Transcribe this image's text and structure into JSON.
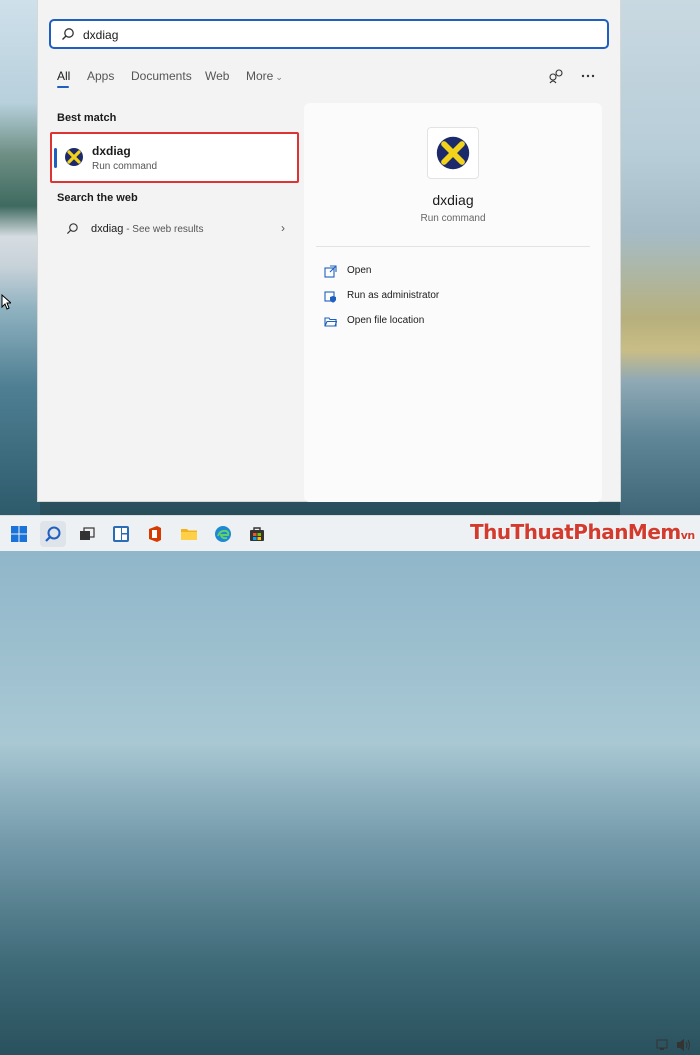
{
  "search": {
    "value": "dxdiag"
  },
  "tabs": [
    {
      "label": "All",
      "active": true
    },
    {
      "label": "Apps",
      "active": false
    },
    {
      "label": "Documents",
      "active": false
    },
    {
      "label": "Web",
      "active": false
    },
    {
      "label": "More",
      "active": false
    }
  ],
  "sections": {
    "best_match": "Best match",
    "search_web": "Search the web"
  },
  "best_match": {
    "name": "dxdiag",
    "subtitle": "Run command",
    "highlight_color": "#dd3333"
  },
  "web_result": {
    "query": "dxdiag",
    "suffix": " - See web results"
  },
  "detail": {
    "name": "dxdiag",
    "subtitle": "Run command",
    "actions": [
      {
        "label": "Open",
        "icon": "open-icon"
      },
      {
        "label": "Run as administrator",
        "icon": "shield-admin-icon"
      },
      {
        "label": "Open file location",
        "icon": "folder-open-icon"
      }
    ]
  },
  "watermark": "ThuThuatPhanMem",
  "watermark_suffix": "vn",
  "colors": {
    "accent": "#1f5fbf",
    "highlight": "#dd3333"
  }
}
